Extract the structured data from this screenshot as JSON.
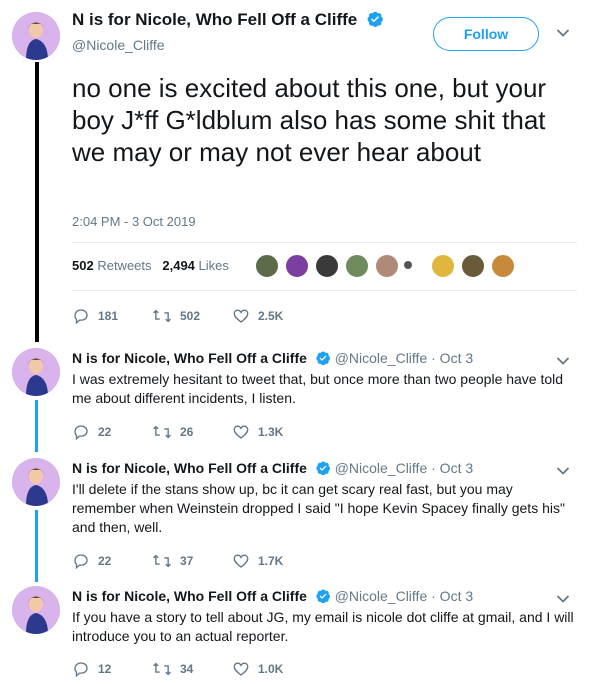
{
  "author": {
    "name": "N is for Nicole, Who Fell Off a Cliffe",
    "handle": "@Nicole_Cliffe",
    "verified": true,
    "avatar_color": "#d8b3ec"
  },
  "follow_label": "Follow",
  "main_tweet": {
    "text": "no one is excited about this one, but your boy J*ff G*ldblum also has some shit that we may or may not ever hear about",
    "timestamp": "2:04 PM - 3 Oct 2019",
    "retweets_count": "502",
    "retweets_label": "Retweets",
    "likes_count": "2,494",
    "likes_label": "Likes",
    "likers": [
      "avatar-1",
      "avatar-2",
      "avatar-3",
      "avatar-4",
      "avatar-5",
      "avatar-6",
      "avatar-7",
      "avatar-8",
      "avatar-9"
    ],
    "actions": {
      "replies": "181",
      "retweets": "502",
      "likes": "2.5K"
    }
  },
  "replies": [
    {
      "name": "N is for Nicole, Who Fell Off a Cliffe",
      "handle": "@Nicole_Cliffe · Oct 3",
      "text": "I was extremely hesitant to tweet that, but once more than two people have told me about different incidents, I listen.",
      "actions": {
        "replies": "22",
        "retweets": "26",
        "likes": "1.3K"
      }
    },
    {
      "name": "N is for Nicole, Who Fell Off a Cliffe",
      "handle": "@Nicole_Cliffe · Oct 3",
      "text": "I'll delete if the stans show up, bc it can get scary real fast, but you may remember when Weinstein dropped I said \"I hope Kevin Spacey finally gets his\" and then, well.",
      "actions": {
        "replies": "22",
        "retweets": "37",
        "likes": "1.7K"
      }
    },
    {
      "name": "N is for Nicole, Who Fell Off a Cliffe",
      "handle": "@Nicole_Cliffe · Oct 3",
      "text": "If you have a story to tell about JG, my email is nicole dot cliffe at gmail, and I will introduce you to an actual reporter.",
      "actions": {
        "replies": "12",
        "retweets": "34",
        "likes": "1.0K"
      }
    }
  ],
  "colors": {
    "accent": "#1da1f2",
    "muted": "#657786",
    "text": "#14171a",
    "thread_line": "#000000"
  }
}
